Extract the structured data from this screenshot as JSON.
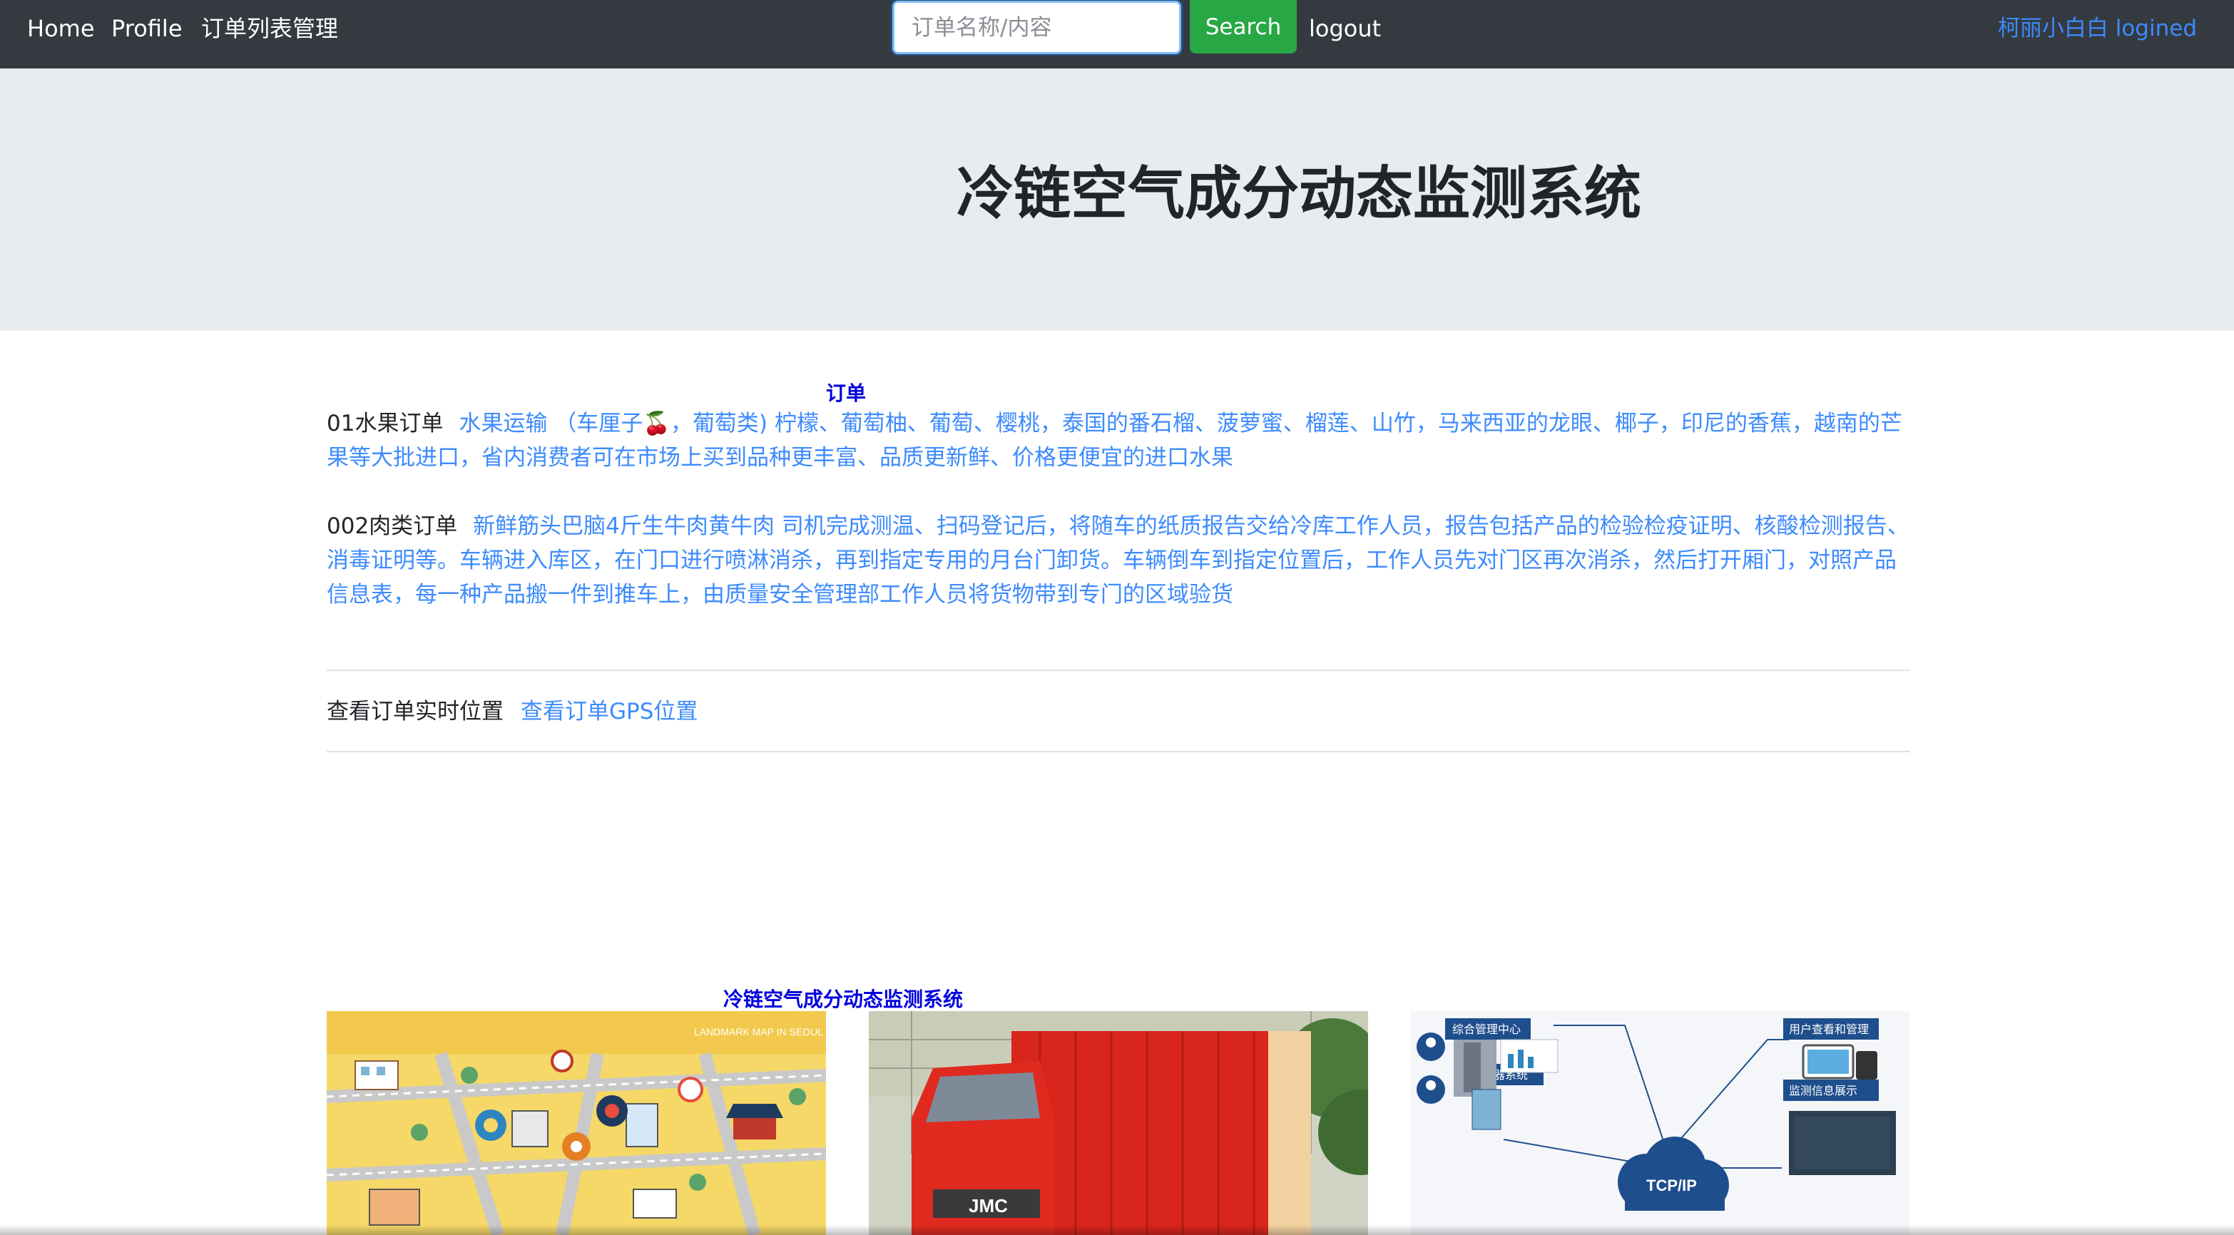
{
  "navbar": {
    "home": "Home",
    "profile": "Profile",
    "orders_manage": "订单列表管理",
    "search_placeholder": "订单名称/内容",
    "search_button": "Search",
    "logout": "logout",
    "user_status": "柯丽小白白 logined"
  },
  "jumbotron": {
    "title": "冷链空气成分动态监测系统"
  },
  "orders": {
    "heading": "订单",
    "items": [
      {
        "label": "01水果订单",
        "description": "水果运输 （车厘子🍒，葡萄类) 柠檬、葡萄柚、葡萄、樱桃，泰国的番石榴、菠萝蜜、榴莲、山竹，马来西亚的龙眼、椰子，印尼的香蕉，越南的芒果等大批进口，省内消费者可在市场上买到品种更丰富、品质更新鲜、价格更便宜的进口水果"
      },
      {
        "label": "002肉类订单",
        "description": "新鲜筋头巴脑4斤生牛肉黄牛肉 司机完成测温、扫码登记后，将随车的纸质报告交给冷库工作人员，报告包括产品的检验检疫证明、核酸检测报告、消毒证明等。车辆进入库区，在门口进行喷淋消杀，再到指定专用的月台门卸货。车辆倒车到指定位置后，工作人员先对门区再次消杀，然后打开厢门，对照产品信息表，每一种产品搬一件到推车上，由质量安全管理部工作人员将货物带到专门的区域验货"
      }
    ]
  },
  "gps": {
    "label": "查看订单实时位置",
    "link": "查看订单GPS位置"
  },
  "gallery": {
    "heading": "冷链空气成分动态监测系统",
    "map_title": "LANDMARK MAP IN SEOUL",
    "net_labels": {
      "center": "综合管理中心",
      "server": "服务器系统",
      "users": "用户查看和管理",
      "monitor": "监测信息展示",
      "protocol": "TCP/IP"
    },
    "truck_brand": "JMC"
  },
  "colors": {
    "navbar_bg": "#343a40",
    "search_green": "#28a745",
    "link_blue": "#3d8bfd",
    "heading_blue": "#0000dd",
    "jumbotron_bg": "#e9ecef"
  }
}
